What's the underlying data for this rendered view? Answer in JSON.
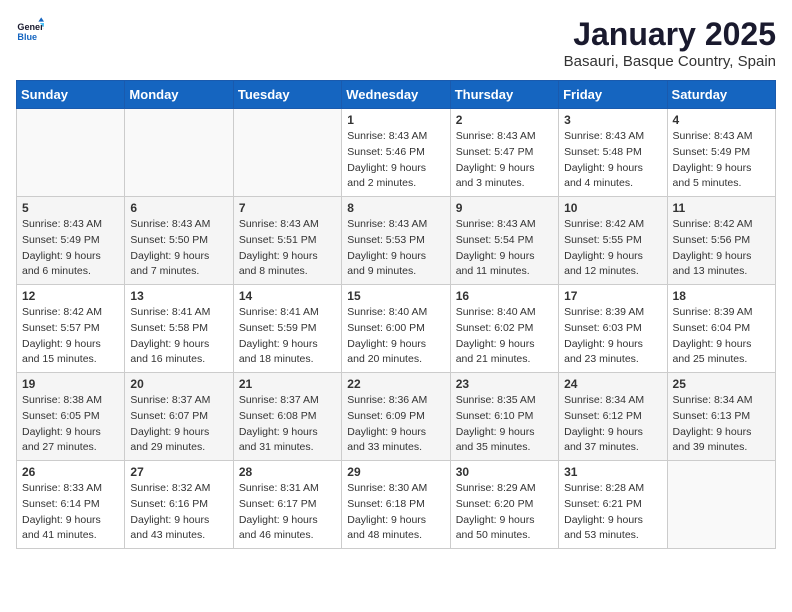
{
  "header": {
    "logo_general": "General",
    "logo_blue": "Blue",
    "month_title": "January 2025",
    "location": "Basauri, Basque Country, Spain"
  },
  "days_of_week": [
    "Sunday",
    "Monday",
    "Tuesday",
    "Wednesday",
    "Thursday",
    "Friday",
    "Saturday"
  ],
  "weeks": [
    [
      {
        "day": "",
        "info": ""
      },
      {
        "day": "",
        "info": ""
      },
      {
        "day": "",
        "info": ""
      },
      {
        "day": "1",
        "sunrise": "8:43 AM",
        "sunset": "5:46 PM",
        "daylight": "9 hours and 2 minutes."
      },
      {
        "day": "2",
        "sunrise": "8:43 AM",
        "sunset": "5:47 PM",
        "daylight": "9 hours and 3 minutes."
      },
      {
        "day": "3",
        "sunrise": "8:43 AM",
        "sunset": "5:48 PM",
        "daylight": "9 hours and 4 minutes."
      },
      {
        "day": "4",
        "sunrise": "8:43 AM",
        "sunset": "5:49 PM",
        "daylight": "9 hours and 5 minutes."
      }
    ],
    [
      {
        "day": "5",
        "sunrise": "8:43 AM",
        "sunset": "5:49 PM",
        "daylight": "9 hours and 6 minutes."
      },
      {
        "day": "6",
        "sunrise": "8:43 AM",
        "sunset": "5:50 PM",
        "daylight": "9 hours and 7 minutes."
      },
      {
        "day": "7",
        "sunrise": "8:43 AM",
        "sunset": "5:51 PM",
        "daylight": "9 hours and 8 minutes."
      },
      {
        "day": "8",
        "sunrise": "8:43 AM",
        "sunset": "5:53 PM",
        "daylight": "9 hours and 9 minutes."
      },
      {
        "day": "9",
        "sunrise": "8:43 AM",
        "sunset": "5:54 PM",
        "daylight": "9 hours and 11 minutes."
      },
      {
        "day": "10",
        "sunrise": "8:42 AM",
        "sunset": "5:55 PM",
        "daylight": "9 hours and 12 minutes."
      },
      {
        "day": "11",
        "sunrise": "8:42 AM",
        "sunset": "5:56 PM",
        "daylight": "9 hours and 13 minutes."
      }
    ],
    [
      {
        "day": "12",
        "sunrise": "8:42 AM",
        "sunset": "5:57 PM",
        "daylight": "9 hours and 15 minutes."
      },
      {
        "day": "13",
        "sunrise": "8:41 AM",
        "sunset": "5:58 PM",
        "daylight": "9 hours and 16 minutes."
      },
      {
        "day": "14",
        "sunrise": "8:41 AM",
        "sunset": "5:59 PM",
        "daylight": "9 hours and 18 minutes."
      },
      {
        "day": "15",
        "sunrise": "8:40 AM",
        "sunset": "6:00 PM",
        "daylight": "9 hours and 20 minutes."
      },
      {
        "day": "16",
        "sunrise": "8:40 AM",
        "sunset": "6:02 PM",
        "daylight": "9 hours and 21 minutes."
      },
      {
        "day": "17",
        "sunrise": "8:39 AM",
        "sunset": "6:03 PM",
        "daylight": "9 hours and 23 minutes."
      },
      {
        "day": "18",
        "sunrise": "8:39 AM",
        "sunset": "6:04 PM",
        "daylight": "9 hours and 25 minutes."
      }
    ],
    [
      {
        "day": "19",
        "sunrise": "8:38 AM",
        "sunset": "6:05 PM",
        "daylight": "9 hours and 27 minutes."
      },
      {
        "day": "20",
        "sunrise": "8:37 AM",
        "sunset": "6:07 PM",
        "daylight": "9 hours and 29 minutes."
      },
      {
        "day": "21",
        "sunrise": "8:37 AM",
        "sunset": "6:08 PM",
        "daylight": "9 hours and 31 minutes."
      },
      {
        "day": "22",
        "sunrise": "8:36 AM",
        "sunset": "6:09 PM",
        "daylight": "9 hours and 33 minutes."
      },
      {
        "day": "23",
        "sunrise": "8:35 AM",
        "sunset": "6:10 PM",
        "daylight": "9 hours and 35 minutes."
      },
      {
        "day": "24",
        "sunrise": "8:34 AM",
        "sunset": "6:12 PM",
        "daylight": "9 hours and 37 minutes."
      },
      {
        "day": "25",
        "sunrise": "8:34 AM",
        "sunset": "6:13 PM",
        "daylight": "9 hours and 39 minutes."
      }
    ],
    [
      {
        "day": "26",
        "sunrise": "8:33 AM",
        "sunset": "6:14 PM",
        "daylight": "9 hours and 41 minutes."
      },
      {
        "day": "27",
        "sunrise": "8:32 AM",
        "sunset": "6:16 PM",
        "daylight": "9 hours and 43 minutes."
      },
      {
        "day": "28",
        "sunrise": "8:31 AM",
        "sunset": "6:17 PM",
        "daylight": "9 hours and 46 minutes."
      },
      {
        "day": "29",
        "sunrise": "8:30 AM",
        "sunset": "6:18 PM",
        "daylight": "9 hours and 48 minutes."
      },
      {
        "day": "30",
        "sunrise": "8:29 AM",
        "sunset": "6:20 PM",
        "daylight": "9 hours and 50 minutes."
      },
      {
        "day": "31",
        "sunrise": "8:28 AM",
        "sunset": "6:21 PM",
        "daylight": "9 hours and 53 minutes."
      },
      {
        "day": "",
        "info": ""
      }
    ]
  ]
}
